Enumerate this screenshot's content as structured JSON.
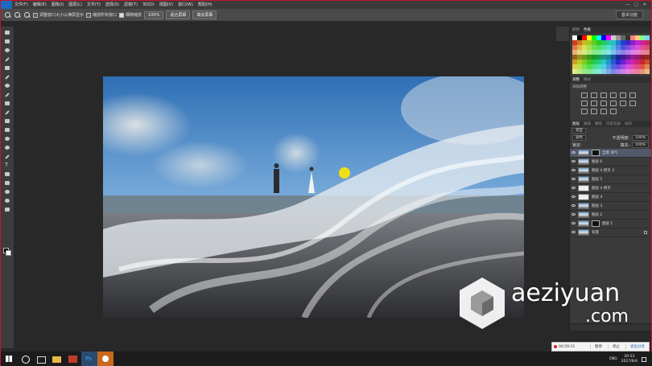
{
  "menubar": {
    "items": [
      "文件(F)",
      "编辑(E)",
      "图像(I)",
      "图层(L)",
      "文字(Y)",
      "选择(S)",
      "滤镜(T)",
      "3D(D)",
      "视图(V)",
      "窗口(W)",
      "帮助(H)"
    ],
    "minimize": "—",
    "maximize": "□",
    "close": "✕"
  },
  "optbar": {
    "resize_windows": "调整窗口大小以满屏显示",
    "zoom_all": "缩放所有窗口",
    "scrubby_zoom": "细微缩放",
    "btn_100": "100%",
    "btn_fit": "适合屏幕",
    "btn_fill": "填充屏幕",
    "workspace": "基本功能"
  },
  "panel": {
    "swatch_tabs": [
      "颜色",
      "色板"
    ],
    "adjust_tabs": [
      "调整",
      "样式"
    ],
    "adjust_label": "添加调整",
    "layer_tabs": [
      "图层",
      "通道",
      "路径",
      "历史记录",
      "动作"
    ],
    "kind_label": "类型",
    "blend_mode": "滤色",
    "opacity_label": "不透明度:",
    "opacity_value": "100%",
    "lock_label": "锁定:",
    "fill_label": "填充:",
    "fill_value": "100%"
  },
  "layers": [
    {
      "name": "全景 洋气",
      "type": "mask",
      "selected": true
    },
    {
      "name": "图层 6",
      "type": "photo"
    },
    {
      "name": "图层 4 拷贝 3",
      "type": "photo"
    },
    {
      "name": "图层 5",
      "type": "photo"
    },
    {
      "name": "图层 4 拷贝",
      "type": "white"
    },
    {
      "name": "图层 4",
      "type": "white"
    },
    {
      "name": "图层 3",
      "type": "photo"
    },
    {
      "name": "图层 2",
      "type": "photo"
    },
    {
      "name": "图层 1",
      "type": "mask2"
    },
    {
      "name": "背景",
      "type": "photo",
      "locked": true
    }
  ],
  "watermark": {
    "text": "aeziyuan",
    "com": ".com"
  },
  "recbar": {
    "timer": "00:59:15",
    "pause": "暂停",
    "stop": "停止",
    "quit": "退出分享"
  },
  "taskbar": {
    "ime": "ENG",
    "time": "20:53",
    "date": "2017/6/4"
  },
  "colors": {
    "accent": "#c8102e",
    "ps_blue": "#31a8ff"
  }
}
